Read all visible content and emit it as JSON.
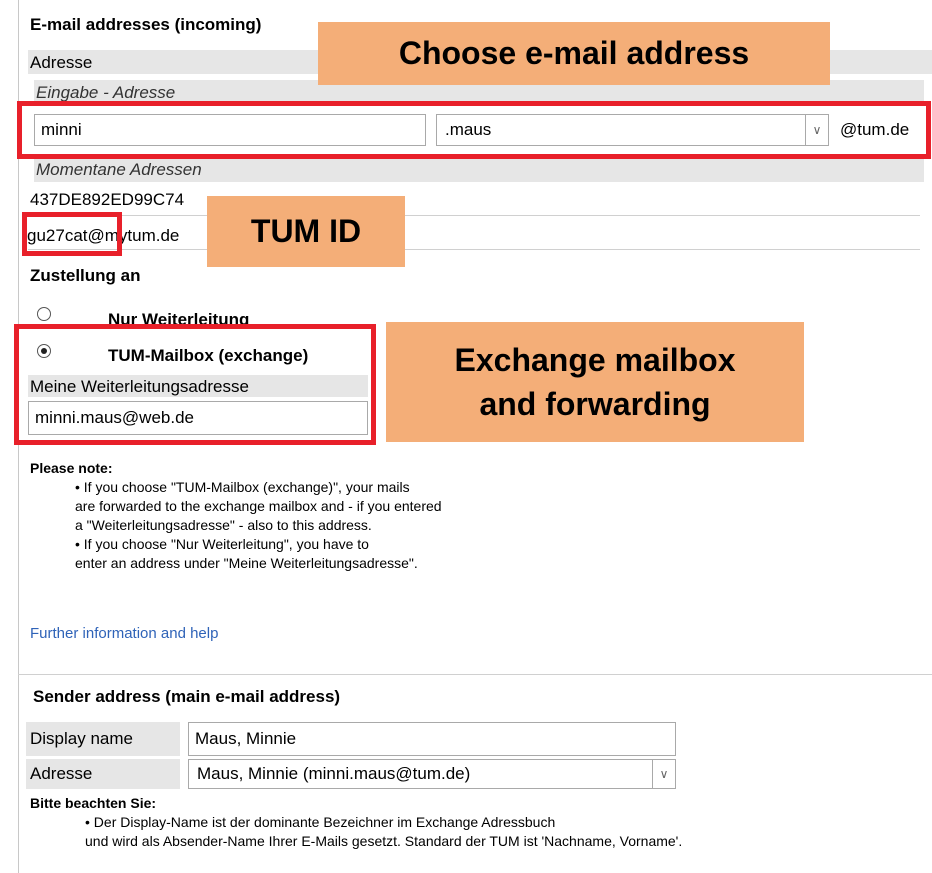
{
  "incoming": {
    "title": "E-mail addresses (incoming)",
    "adresse_label": "Adresse",
    "eingabe_label": "Eingabe - Adresse",
    "local_input_value": "minni",
    "domain_select_value": ".maus",
    "domain_suffix": "@tum.de",
    "momentane_label": "Momentane Adressen",
    "addresses": [
      "437DE892ED99C74",
      "gu27cat@mytum.de"
    ]
  },
  "delivery": {
    "title": "Zustellung an",
    "options": [
      {
        "label": "Nur Weiterleitung",
        "checked": false
      },
      {
        "label": "TUM-Mailbox (exchange)",
        "checked": true
      }
    ],
    "forward_label": "Meine Weiterleitungsadresse",
    "forward_value": "minni.maus@web.de"
  },
  "note": {
    "heading": "Please note:",
    "lines": [
      "• If you choose \"TUM-Mailbox (exchange)\", your mails",
      "are forwarded to the exchange mailbox and - if you entered",
      "a \"Weiterleitungsadresse\" - also to this address.",
      "• If you choose \"Nur Weiterleitung\", you have to",
      "enter an address under \"Meine Weiterleitungsadresse\"."
    ],
    "help_link": "Further information and help"
  },
  "sender": {
    "title": "Sender address (main e-mail address)",
    "display_label": "Display name",
    "display_value": "Maus, Minnie",
    "adresse_label": "Adresse",
    "adresse_value": "Maus, Minnie (minni.maus@tum.de)",
    "hint_heading": "Bitte beachten Sie:",
    "hint_lines": [
      "• Der Display-Name ist der dominante Bezeichner im Exchange Adressbuch",
      "und wird als Absender-Name Ihrer E-Mails gesetzt. Standard der TUM ist 'Nachname, Vorname'."
    ]
  },
  "callouts": {
    "choose": "Choose e-mail address",
    "tumid": "TUM ID",
    "exchange_line1": "Exchange mailbox",
    "exchange_line2": "and forwarding"
  },
  "colors": {
    "highlight_red": "#e8202a",
    "callout_orange": "#f4ae78",
    "link_blue": "#2f63b8"
  }
}
